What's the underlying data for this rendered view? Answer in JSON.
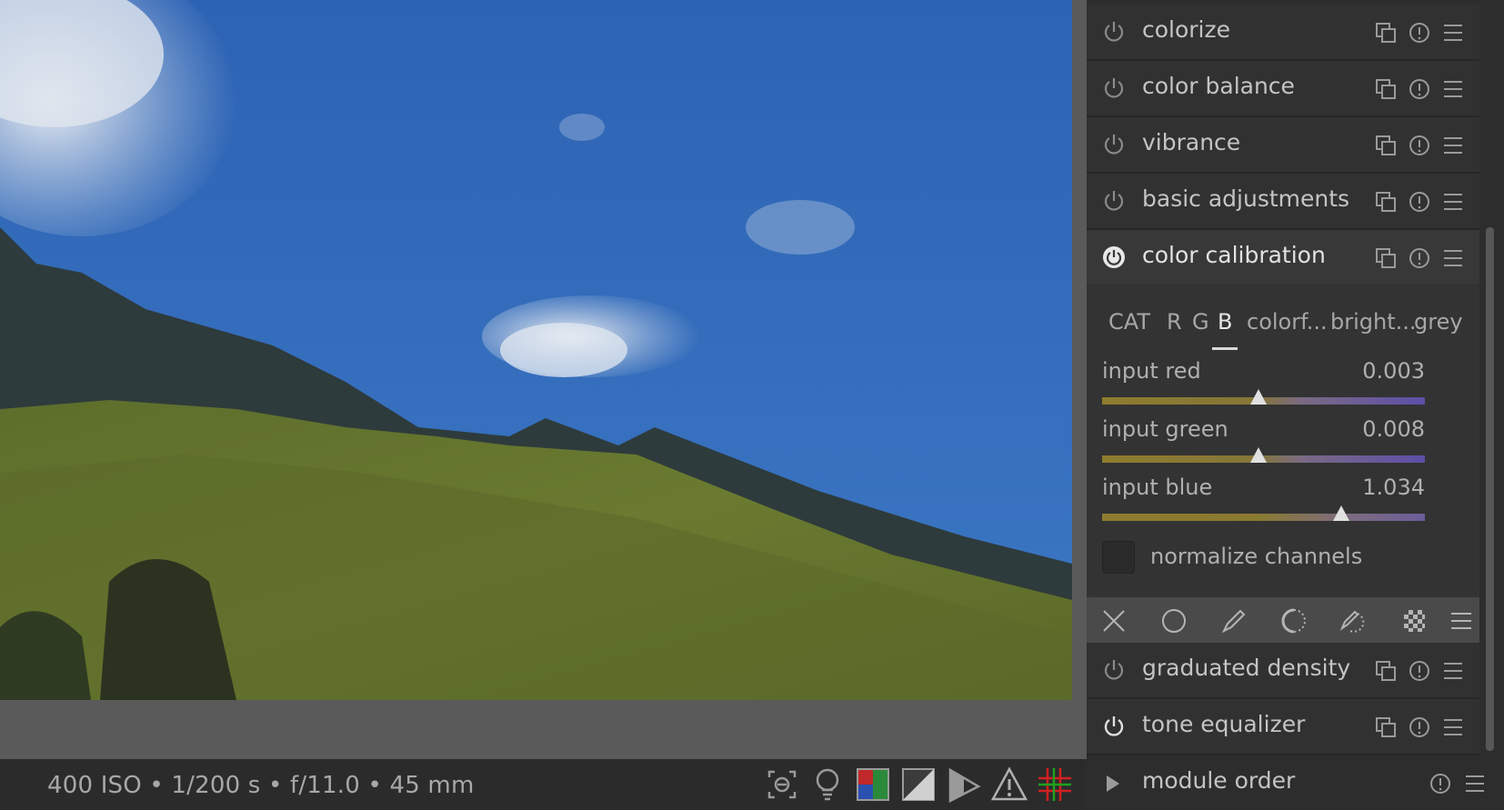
{
  "exif": {
    "text": "400 ISO • 1/200 s • f/11.0 • 45 mm"
  },
  "bottom_icons": [
    "focus-peaking-icon",
    "lightbulb-icon",
    "color-assessment-icon",
    "raw-overexposed-icon",
    "softproof-icon",
    "gamut-check-icon",
    "guides-icon"
  ],
  "modules": [
    {
      "name": "colorize",
      "enabled": false
    },
    {
      "name": "color balance",
      "enabled": false
    },
    {
      "name": "vibrance",
      "enabled": false
    },
    {
      "name": "basic adjustments",
      "enabled": false
    },
    {
      "name": "color calibration",
      "enabled": true,
      "expanded": true
    },
    {
      "name": "graduated density",
      "enabled": false
    },
    {
      "name": "tone equalizer",
      "enabled": true
    }
  ],
  "color_calibration": {
    "tabs": [
      "CAT",
      "R",
      "G",
      "B",
      "colorf...",
      "bright...",
      "grey"
    ],
    "active_tab": "B",
    "sliders": [
      {
        "label": "input red",
        "value": "0.003"
      },
      {
        "label": "input green",
        "value": "0.008"
      },
      {
        "label": "input blue",
        "value": "1.034"
      }
    ],
    "normalize_label": "normalize channels"
  },
  "mask_icons": [
    "off-icon",
    "uniform-icon",
    "drawn-mask-icon",
    "parametric-mask-icon",
    "drawn-parametric-mask-icon",
    "raster-mask-icon",
    "blend-options-icon"
  ],
  "module_order": {
    "label": "module order"
  }
}
